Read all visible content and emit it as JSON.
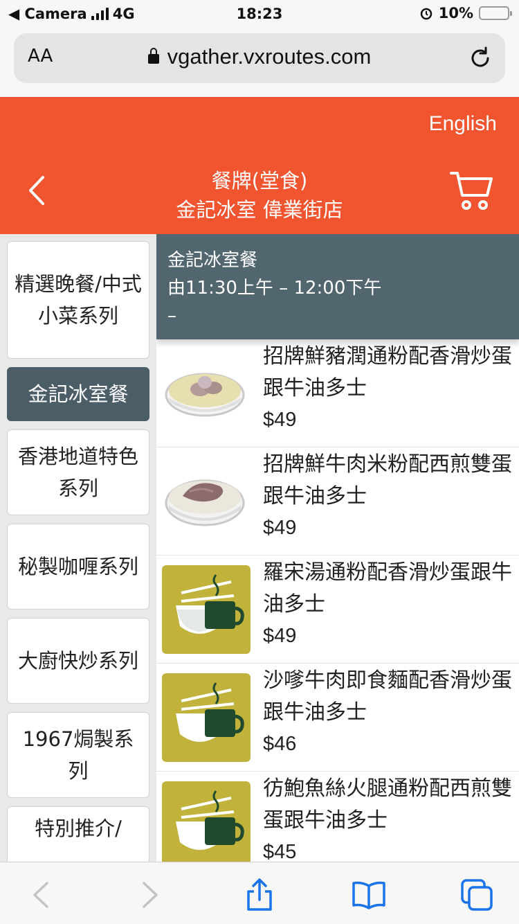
{
  "status_bar": {
    "carrier": "◀ Camera",
    "network": "4G",
    "time": "18:23",
    "battery": "10%"
  },
  "browser": {
    "text_size_label": "AA",
    "url": "vgather.vxroutes.com"
  },
  "header": {
    "language": "English",
    "title": "餐牌(堂食)",
    "subtitle": "金記冰室 偉業街店",
    "bg_color": "#f05530"
  },
  "categories": [
    {
      "label": "精選晚餐/中式小菜系列",
      "active": false
    },
    {
      "label": "金記冰室餐",
      "active": true
    },
    {
      "label": "香港地道特色系列",
      "active": false
    },
    {
      "label": "秘製咖喱系列",
      "active": false
    },
    {
      "label": "大廚快炒系列",
      "active": false
    },
    {
      "label": "1967焗製系列",
      "active": false
    },
    {
      "label": "特別推介/",
      "active": false
    }
  ],
  "section": {
    "name": "金記冰室餐",
    "hours": "由11:30上午 – 12:00下午",
    "note": "–"
  },
  "items": [
    {
      "name": "招牌鮮豬潤通粉配香滑炒蛋跟牛油多士",
      "price": "$49",
      "image": "soup-bowl-pork"
    },
    {
      "name": "招牌鮮牛肉米粉配西煎雙蛋跟牛油多士",
      "price": "$49",
      "image": "soup-bowl-beef"
    },
    {
      "name": "羅宋湯通粉配香滑炒蛋跟牛油多士",
      "price": "$49",
      "image": "cafe-logo"
    },
    {
      "name": "沙嗲牛肉即食麵配香滑炒蛋跟牛油多士",
      "price": "$46",
      "image": "cafe-logo"
    },
    {
      "name": "彷鮑魚絲火腿通粉配西煎雙蛋跟牛油多士",
      "price": "$45",
      "image": "cafe-logo"
    }
  ]
}
